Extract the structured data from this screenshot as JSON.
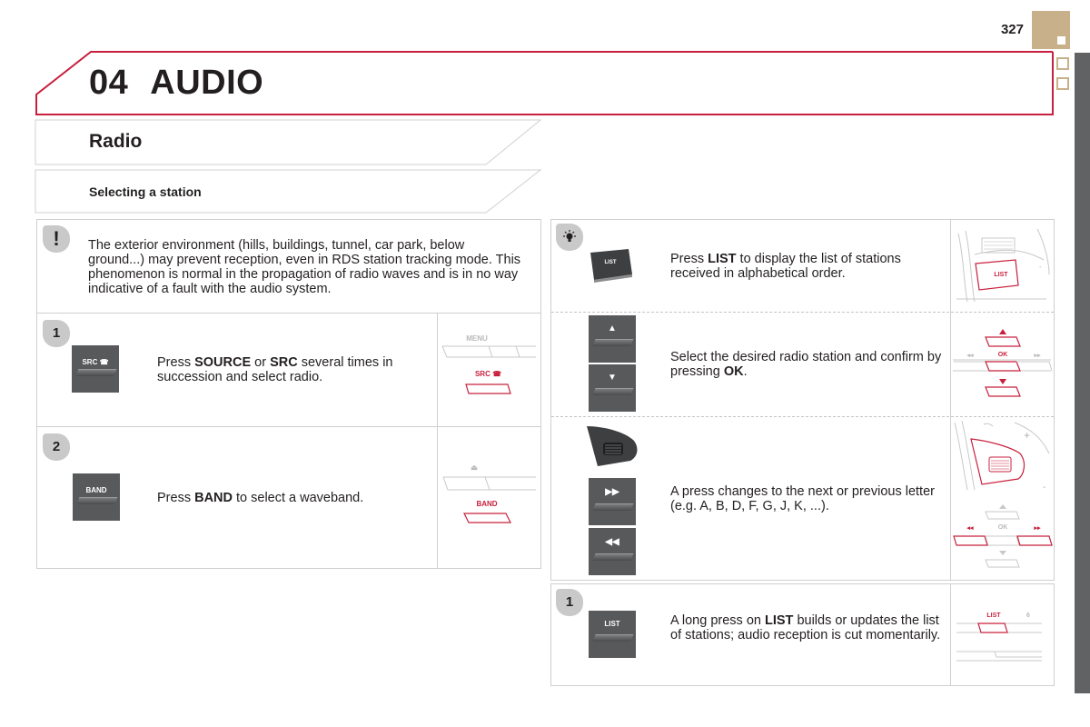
{
  "page": {
    "number": "327",
    "accent_color": "#c8203d",
    "tab_color": "#c8b08a",
    "sidebar_color": "#616264"
  },
  "chapter": {
    "number": "04",
    "title": "AUDIO"
  },
  "section": {
    "title": "Radio",
    "subtitle": "Selecting a station"
  },
  "left_column": {
    "warning": {
      "icon": "exclamation-icon",
      "badge": "!",
      "text": "The exterior environment (hills, buildings, tunnel, car park, below ground...) may prevent reception, even in RDS station tracking mode. This phenomenon is normal in the propagation of radio waves and is in no way indicative of a fault with the audio system."
    },
    "steps": [
      {
        "number": "1",
        "key_label": "SRC",
        "key_icon": "phone-icon",
        "text_parts": [
          "Press ",
          "SOURCE",
          " or ",
          "SRC",
          " several times in succession and select radio."
        ],
        "diagram": {
          "top_label": "MENU",
          "highlight_label": "SRC"
        }
      },
      {
        "number": "2",
        "key_label": "BAND",
        "text_parts": [
          "Press ",
          "BAND",
          " to select a waveband."
        ],
        "diagram": {
          "top_icon": "eject-icon",
          "highlight_label": "BAND"
        }
      }
    ]
  },
  "right_column": {
    "tip": {
      "icon": "lightbulb-icon",
      "rows": [
        {
          "key_label": "LIST",
          "text_parts": [
            "Press ",
            "LIST",
            " to display the list of stations received in alphabetical order."
          ],
          "diagram": {
            "highlight_label": "LIST"
          }
        },
        {
          "keys": [
            "up-arrow",
            "down-arrow"
          ],
          "text_parts": [
            "Select the desired radio station and confirm by pressing ",
            "OK",
            "."
          ],
          "diagram": {
            "left_label": "◂◂",
            "center_label": "OK",
            "right_label": "▸▸"
          }
        },
        {
          "keys": [
            "steering-wheel-control",
            "fast-forward",
            "rewind"
          ],
          "text_parts": [
            "A press changes to the next or previous letter (e.g. A, B, D, F, G, J, K, ...)."
          ],
          "diagram": {
            "left_label": "◂◂",
            "center_label": "OK",
            "right_label": "▸▸",
            "plus": "+",
            "minus": "-"
          }
        }
      ]
    },
    "step": {
      "number": "1",
      "key_label": "LIST",
      "text_parts": [
        "A long press on ",
        "LIST",
        " builds or updates the list of stations; audio reception is cut momentarily."
      ],
      "diagram": {
        "highlight_label": "LIST",
        "side_label": "6"
      }
    }
  }
}
